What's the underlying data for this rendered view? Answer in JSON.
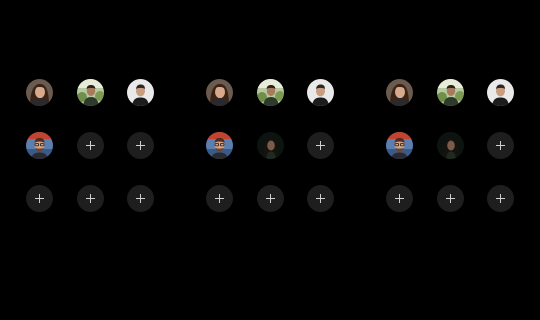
{
  "screen": {
    "background": "#000000"
  },
  "icons": {
    "add": "plus-icon"
  },
  "panels": [
    {
      "id": "panel-1",
      "slots": [
        {
          "kind": "avatar",
          "avatar": "woman-brown-hair"
        },
        {
          "kind": "avatar",
          "avatar": "man-outdoors-green"
        },
        {
          "kind": "avatar",
          "avatar": "man-light-background"
        },
        {
          "kind": "avatar",
          "avatar": "man-glasses-beard"
        },
        {
          "kind": "add"
        },
        {
          "kind": "add"
        },
        {
          "kind": "add"
        },
        {
          "kind": "add"
        },
        {
          "kind": "add"
        }
      ]
    },
    {
      "id": "panel-2",
      "slots": [
        {
          "kind": "avatar",
          "avatar": "woman-brown-hair"
        },
        {
          "kind": "avatar",
          "avatar": "man-outdoors-green"
        },
        {
          "kind": "avatar",
          "avatar": "man-light-background"
        },
        {
          "kind": "avatar",
          "avatar": "man-glasses-beard"
        },
        {
          "kind": "avatar",
          "avatar": "woman-dark-portrait"
        },
        {
          "kind": "add"
        },
        {
          "kind": "add"
        },
        {
          "kind": "add"
        },
        {
          "kind": "add"
        }
      ]
    },
    {
      "id": "panel-3",
      "slots": [
        {
          "kind": "avatar",
          "avatar": "woman-brown-hair"
        },
        {
          "kind": "avatar",
          "avatar": "man-outdoors-green"
        },
        {
          "kind": "avatar",
          "avatar": "man-light-background"
        },
        {
          "kind": "avatar",
          "avatar": "man-glasses-beard"
        },
        {
          "kind": "avatar",
          "avatar": "woman-dark-portrait"
        },
        {
          "kind": "add"
        },
        {
          "kind": "add"
        },
        {
          "kind": "add"
        },
        {
          "kind": "add"
        }
      ]
    }
  ]
}
